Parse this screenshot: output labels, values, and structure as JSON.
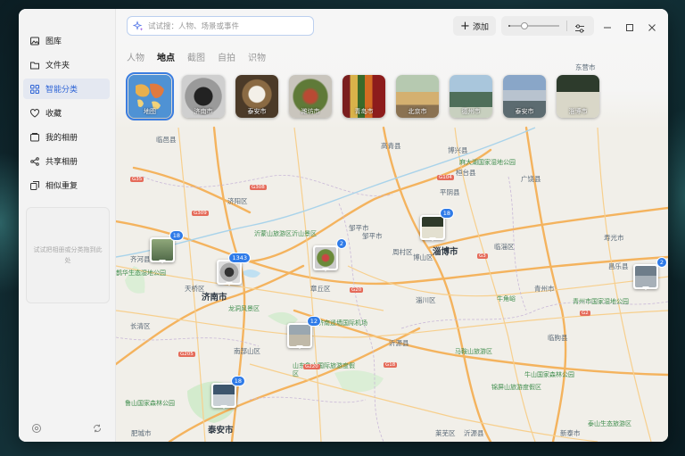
{
  "sidebar": {
    "items": [
      {
        "label": "图库",
        "icon": "image-icon",
        "active": false
      },
      {
        "label": "文件夹",
        "icon": "folder-icon",
        "active": false
      },
      {
        "label": "智能分类",
        "icon": "grid-icon",
        "active": true
      },
      {
        "label": "收藏",
        "icon": "heart-icon",
        "active": false
      },
      {
        "label": "我的相册",
        "icon": "album-icon",
        "active": false
      },
      {
        "label": "共享相册",
        "icon": "share-icon",
        "active": false
      },
      {
        "label": "相似重复",
        "icon": "duplicate-icon",
        "active": false
      }
    ],
    "hint": "试试把相册或分类拖到此处"
  },
  "search": {
    "placeholder": "试试搜：人物、场景或事件"
  },
  "toolbar": {
    "add_label": "添加"
  },
  "tabs": [
    {
      "label": "人物",
      "active": false
    },
    {
      "label": "地点",
      "active": true
    },
    {
      "label": "截图",
      "active": false
    },
    {
      "label": "自拍",
      "active": false
    },
    {
      "label": "识物",
      "active": false
    }
  ],
  "places": [
    {
      "label": "地图",
      "selected": true
    },
    {
      "label": "济南市",
      "selected": false
    },
    {
      "label": "泰安市",
      "selected": false
    },
    {
      "label": "潍坊市",
      "selected": false
    },
    {
      "label": "青岛市",
      "selected": false
    },
    {
      "label": "北京市",
      "selected": false
    },
    {
      "label": "德州市",
      "selected": false
    },
    {
      "label": "泰安市",
      "selected": false
    },
    {
      "label": "淄博市",
      "selected": false
    }
  ],
  "pins": [
    {
      "count": "18"
    },
    {
      "count": "1343"
    },
    {
      "count": "2"
    },
    {
      "count": "18"
    },
    {
      "count": "12"
    },
    {
      "count": "18"
    },
    {
      "count": "2"
    }
  ],
  "map_labels": {
    "cities": [
      "济南市",
      "淄博市",
      "泰安市"
    ],
    "towns": [
      "临邑县",
      "济阳区",
      "高青县",
      "博兴县",
      "广饶县",
      "齐河县",
      "天桥区",
      "邹平市",
      "周村区",
      "临淄区",
      "寿光市",
      "长清区",
      "章丘区",
      "淄川区",
      "青州市",
      "临朐县",
      "沂源县",
      "莱芜区",
      "新泰市",
      "沂源县",
      "南部山区",
      "昌乐县",
      "桓台县",
      "肥城市",
      "滨州市",
      "东营市",
      "邹平市",
      "平阴县",
      "博山区"
    ],
    "parks": [
      "麻大湖国家湿地公园",
      "鹊华生态湿地公园",
      "龙洞风景区",
      "山东鲁山国际旅游度假区",
      "牛角峪",
      "马鞍山旅游区",
      "青州市国家湿地公园",
      "鲁山国家森林公园",
      "牛山国家森林公园",
      "泰山生态旅游区",
      "沂蒙山旅游区沂山景区",
      "济南遥墙国际机场",
      "锦屏山旅游度假区"
    ],
    "roads": [
      "G308",
      "G309",
      "G205",
      "G220",
      "G104",
      "G20",
      "G3",
      "G2",
      "G35",
      "G18"
    ]
  }
}
